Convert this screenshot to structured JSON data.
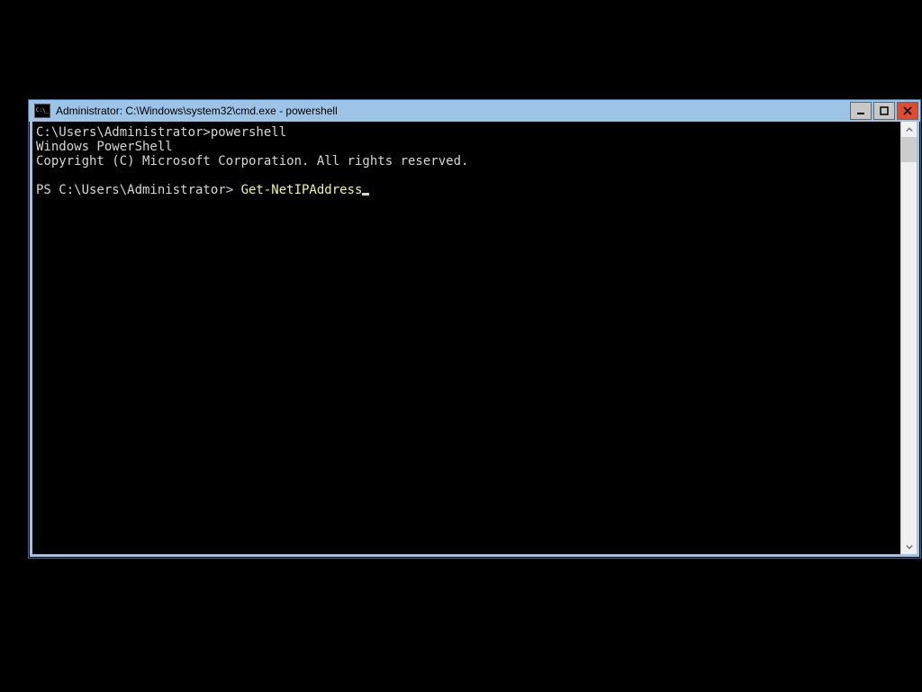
{
  "window": {
    "title": "Administrator: C:\\Windows\\system32\\cmd.exe - powershell"
  },
  "controls": {
    "minimize_tooltip": "Minimize",
    "maximize_tooltip": "Maximize",
    "close_tooltip": "Close"
  },
  "terminal": {
    "line1": "C:\\Users\\Administrator>powershell",
    "line2": "Windows PowerShell",
    "line3": "Copyright (C) Microsoft Corporation. All rights reserved.",
    "blank": "",
    "prompt": "PS C:\\Users\\Administrator> ",
    "command": "Get-NetIPAddress"
  }
}
